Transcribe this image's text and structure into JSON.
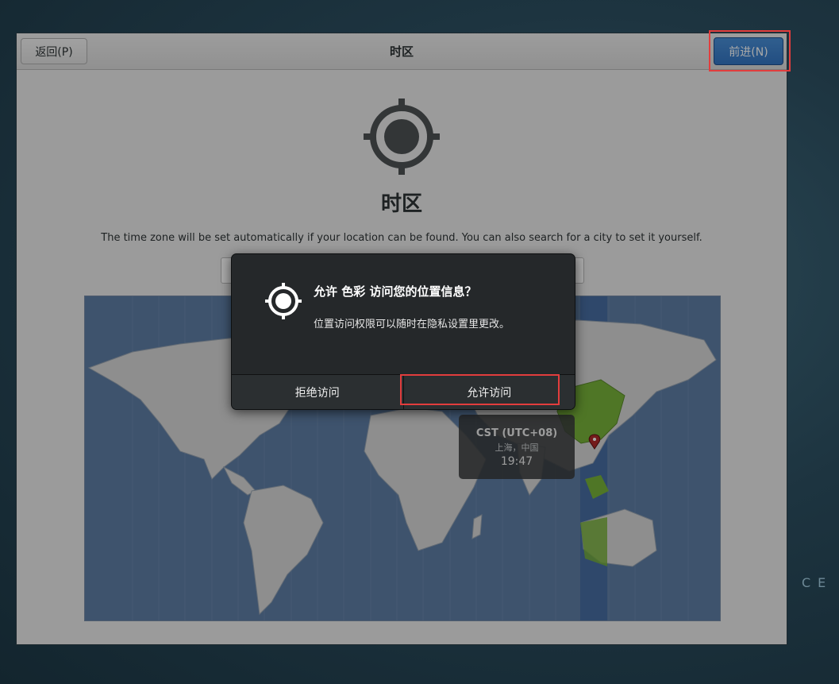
{
  "window": {
    "back_label": "返回(P)",
    "title": "时区",
    "next_label": "前进(N)"
  },
  "main": {
    "heading": "时区",
    "description": "The time zone will be set automatically if your location can be found. You can also search for a city to set it yourself.",
    "search_value": "",
    "icon": "location-crosshair-icon"
  },
  "map": {
    "selected_zone": {
      "abbr": "CST (UTC+08)",
      "city": "上海，中国",
      "time": "19:47"
    },
    "colors": {
      "ocean": "#5f7ea6",
      "land": "#d8d8d8",
      "highlight_band": "#486ea3",
      "selected_country": "#79b33b"
    }
  },
  "dialog": {
    "icon": "location-crosshair-icon",
    "title": "允许 色彩 访问您的位置信息？",
    "message": "位置访问权限可以随时在隐私设置里更改。",
    "deny_label": "拒绝访问",
    "allow_label": "允许访问"
  },
  "desktop": {
    "partial_text": "CE"
  }
}
